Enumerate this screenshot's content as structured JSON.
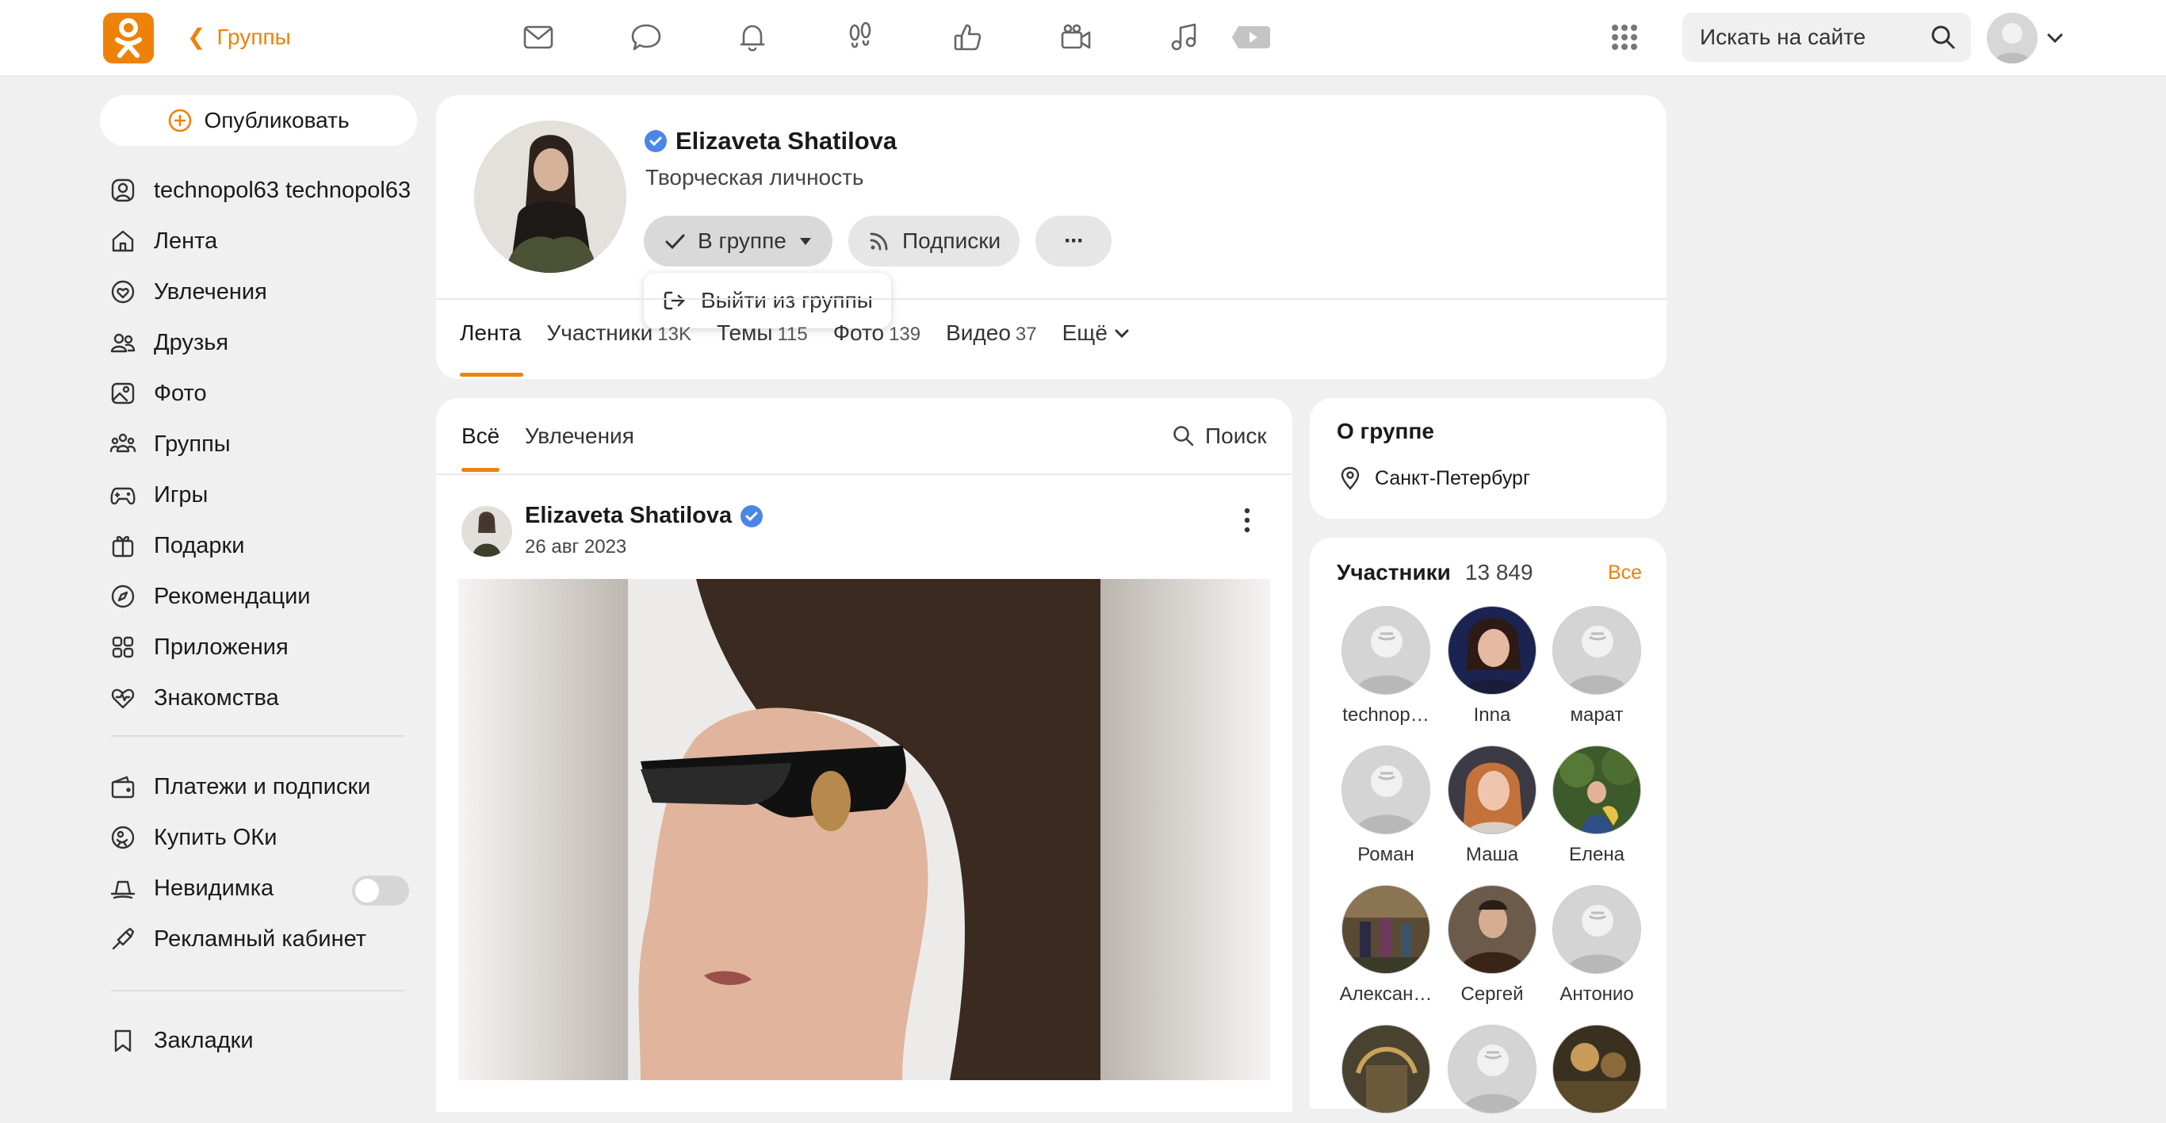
{
  "topbar": {
    "back_label": "Группы",
    "search_placeholder": "Искать на сайте",
    "nav_icons": [
      "messages-icon",
      "discussions-icon",
      "notifications-icon",
      "guests-icon",
      "likes-icon",
      "video-icon",
      "music-icon",
      "play-icon"
    ]
  },
  "sidebar": {
    "publish_label": "Опубликовать",
    "items": [
      {
        "label": "technopol63 technopol63",
        "icon": "user-icon"
      },
      {
        "label": "Лента",
        "icon": "home-icon"
      },
      {
        "label": "Увлечения",
        "icon": "hobby-icon"
      },
      {
        "label": "Друзья",
        "icon": "friends-icon"
      },
      {
        "label": "Фото",
        "icon": "photo-icon"
      },
      {
        "label": "Группы",
        "icon": "groups-icon"
      },
      {
        "label": "Игры",
        "icon": "gamepad-icon"
      },
      {
        "label": "Подарки",
        "icon": "gift-icon"
      },
      {
        "label": "Рекомендации",
        "icon": "compass-icon"
      },
      {
        "label": "Приложения",
        "icon": "apps-icon"
      },
      {
        "label": "Знакомства",
        "icon": "dating-icon"
      }
    ],
    "items2": [
      {
        "label": "Платежи и подписки",
        "icon": "wallet-icon"
      },
      {
        "label": "Купить ОКи",
        "icon": "coins-icon"
      },
      {
        "label": "Невидимка",
        "icon": "incognito-icon"
      },
      {
        "label": "Рекламный кабинет",
        "icon": "ads-icon"
      }
    ],
    "bookmarks_label": "Закладки",
    "invisible_toggle": false
  },
  "group": {
    "name": "Elizaveta Shatilova",
    "subtitle": "Творческая личность",
    "in_group_label": "В группе",
    "subscriptions_label": "Подписки",
    "more_label": "···",
    "leave_label": "Выйти из группы",
    "tabs": [
      {
        "label": "Лента",
        "count": ""
      },
      {
        "label": "Участники",
        "count": "13K"
      },
      {
        "label": "Темы",
        "count": "115"
      },
      {
        "label": "Фото",
        "count": "139"
      },
      {
        "label": "Видео",
        "count": "37"
      },
      {
        "label": "Ещё",
        "count": ""
      }
    ]
  },
  "feed": {
    "tab_all": "Всё",
    "tab_hobby": "Увлечения",
    "search_label": "Поиск",
    "post": {
      "author": "Elizaveta Shatilova",
      "date": "26 авг 2023"
    }
  },
  "about": {
    "title": "О группе",
    "city": "Санкт-Петербург"
  },
  "members": {
    "title": "Участники",
    "count": "13 849",
    "all_label": "Все",
    "list": [
      {
        "name": "technop…"
      },
      {
        "name": "Inna"
      },
      {
        "name": "марат"
      },
      {
        "name": "Роман"
      },
      {
        "name": "Маша"
      },
      {
        "name": "Елена"
      },
      {
        "name": "Алексан…"
      },
      {
        "name": "Сергей"
      },
      {
        "name": "Антонио"
      }
    ]
  },
  "colors": {
    "accent": "#ee8208",
    "verified": "#4a86e8"
  }
}
